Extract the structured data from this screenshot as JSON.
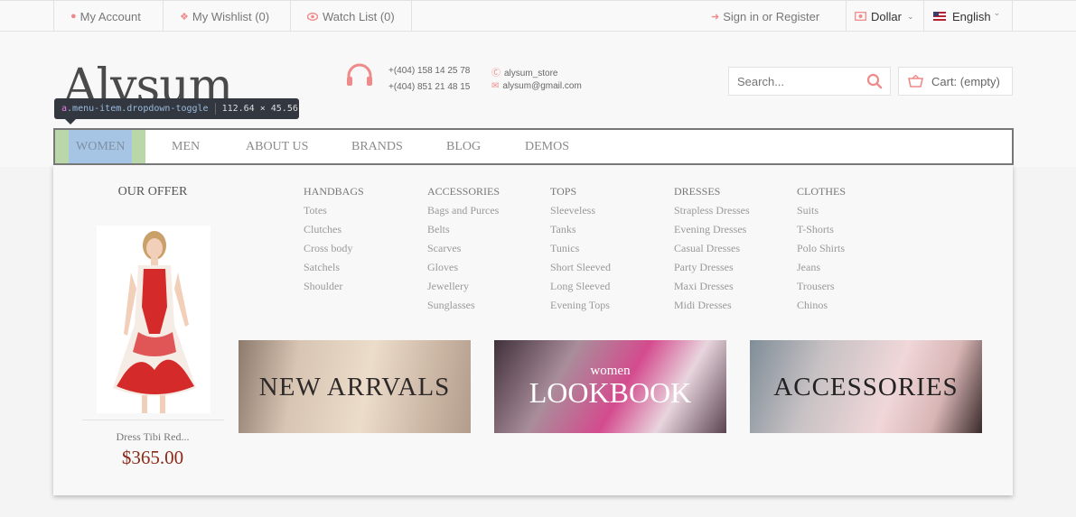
{
  "topbar": {
    "my_account": "My Account",
    "wishlist": "My Wishlist (0)",
    "watch_list": "Watch List (0)",
    "sign_in": "Sign in or Register",
    "currency": "Dollar",
    "language": "English"
  },
  "header": {
    "logo": "Alysum",
    "phone1": "+(404) 158 14 25 78",
    "phone2": "+(404) 851 21 48 15",
    "skype": "alysum_store",
    "email": "alysum@gmail.com",
    "search_placeholder": "Search...",
    "cart": "Cart: (empty)"
  },
  "devtools_tooltip": {
    "tag": "a",
    "class_name": ".menu-item.dropdown-toggle",
    "size": "112.64 × 45.56"
  },
  "nav": {
    "items": [
      "WOMEN",
      "MEN",
      "ABOUT US",
      "BRANDS",
      "BLOG",
      "DEMOS"
    ]
  },
  "dropdown": {
    "offer": {
      "title": "OUR OFFER",
      "product_name": "Dress Tibi Red...",
      "price": "$365.00"
    },
    "columns": [
      {
        "title": "HANDBAGS",
        "items": [
          "Totes",
          "Clutches",
          "Cross body",
          "Satchels",
          "Shoulder"
        ]
      },
      {
        "title": "ACCESSORIES",
        "items": [
          "Bags and Purces",
          "Belts",
          "Scarves",
          "Gloves",
          "Jewellery",
          "Sunglasses"
        ]
      },
      {
        "title": "TOPS",
        "items": [
          "Sleeveless",
          "Tanks",
          "Tunics",
          "Short Sleeved",
          "Long Sleeved",
          "Evening Tops"
        ]
      },
      {
        "title": "DRESSES",
        "items": [
          "Strapless Dresses",
          "Evening Dresses",
          "Casual Dresses",
          "Party Dresses",
          "Maxi Dresses",
          "Midi Dresses"
        ]
      },
      {
        "title": "CLOTHES",
        "items": [
          "Suits",
          "T-Shorts",
          "Polo Shirts",
          "Jeans",
          "Trousers",
          "Chinos"
        ]
      }
    ],
    "banners": {
      "new_arrivals": "New arrvals",
      "lookbook_small": "women",
      "lookbook": "Lookbook",
      "accessories": "Accessories"
    }
  },
  "colors": {
    "accent": "#ef8a8a",
    "price": "#8b2a16",
    "nav_highlight_blue": "#a6c4e4",
    "nav_highlight_green": "#b9d7a8"
  }
}
